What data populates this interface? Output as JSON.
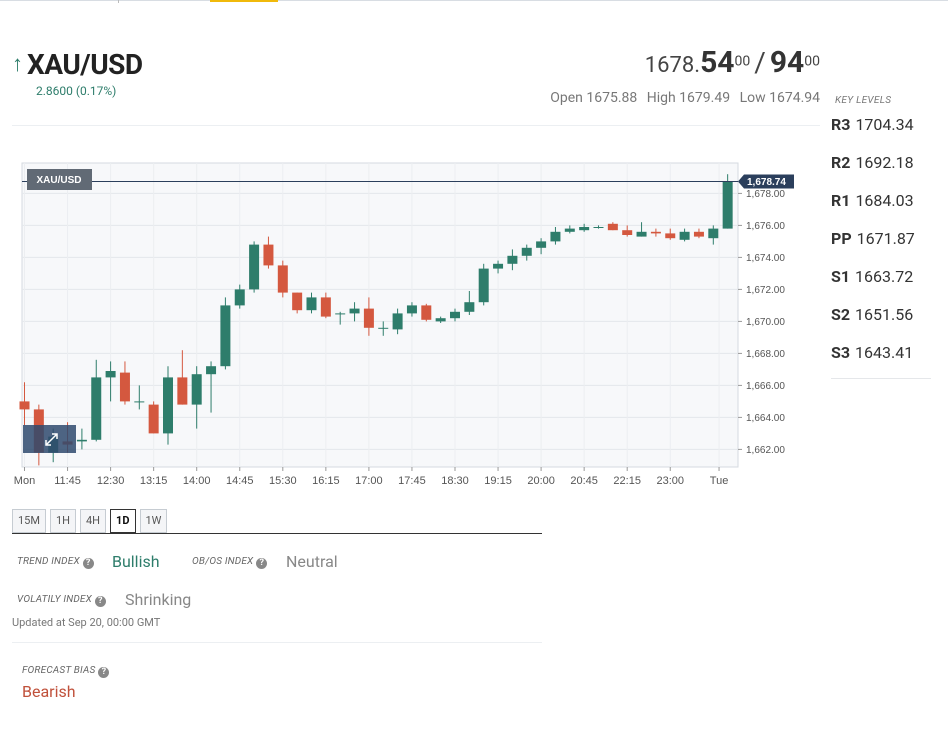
{
  "header": {
    "symbol": "XAU/USD",
    "change": "2.8600 (0.17%)",
    "bid_int": "1678.",
    "bid_big": "54",
    "bid_sup": "00",
    "slash": "/",
    "ask_big": "94",
    "ask_sup": "00",
    "open": "Open 1675.88",
    "high": "High 1679.49",
    "low": "Low 1674.94"
  },
  "key_levels": {
    "title": "KEY LEVELS",
    "items": [
      {
        "name": "R3",
        "value": "1704.34"
      },
      {
        "name": "R2",
        "value": "1692.18"
      },
      {
        "name": "R1",
        "value": "1684.03"
      },
      {
        "name": "PP",
        "value": "1671.87"
      },
      {
        "name": "S1",
        "value": "1663.72"
      },
      {
        "name": "S2",
        "value": "1651.56"
      },
      {
        "name": "S3",
        "value": "1643.41"
      }
    ]
  },
  "chart_data": {
    "type": "candlestick",
    "title": "XAU/USD",
    "current_price_label": "1,678.74",
    "current_price": 1678.74,
    "ylim": [
      1660.9,
      1679.9
    ],
    "y_ticks": [
      1662,
      1664,
      1666,
      1668,
      1670,
      1672,
      1674,
      1676,
      1678
    ],
    "y_tick_labels": [
      "1,662.00",
      "1,664.00",
      "1,666.00",
      "1,668.00",
      "1,670.00",
      "1,672.00",
      "1,674.00",
      "1,676.00",
      "1,678.00"
    ],
    "x_tick_labels": [
      "Mon",
      "11:45",
      "12:30",
      "13:15",
      "14:00",
      "14:45",
      "15:30",
      "16:15",
      "17:00",
      "17:45",
      "18:30",
      "19:15",
      "20:00",
      "20:45",
      "22:15",
      "23:00",
      "Tue"
    ],
    "x_tick_index": [
      0,
      3,
      6,
      9,
      12,
      15,
      18,
      21,
      24,
      27,
      30,
      33,
      36,
      39,
      42,
      45,
      48.4
    ],
    "bull_color": "#2e7d6b",
    "bear_color": "#d4583f",
    "candles": [
      [
        1665.0,
        1666.2,
        1663.5,
        1664.5
      ],
      [
        1664.5,
        1664.8,
        1661.0,
        1661.8
      ],
      [
        1661.8,
        1663.3,
        1661.2,
        1662.8
      ],
      [
        1662.5,
        1663.7,
        1661.8,
        1662.3
      ],
      [
        1662.5,
        1663.3,
        1662.0,
        1662.6
      ],
      [
        1662.6,
        1667.6,
        1662.5,
        1666.5
      ],
      [
        1666.5,
        1667.5,
        1665.0,
        1666.9
      ],
      [
        1666.8,
        1667.5,
        1664.8,
        1665.0
      ],
      [
        1665.0,
        1666.0,
        1664.5,
        1665.0
      ],
      [
        1664.8,
        1665.0,
        1663.0,
        1663.0
      ],
      [
        1663.0,
        1667.2,
        1662.3,
        1666.5
      ],
      [
        1666.5,
        1668.2,
        1664.8,
        1664.8
      ],
      [
        1664.8,
        1667.2,
        1663.3,
        1666.7
      ],
      [
        1666.7,
        1667.5,
        1664.3,
        1667.2
      ],
      [
        1667.2,
        1671.5,
        1667.0,
        1671.0
      ],
      [
        1671.0,
        1672.3,
        1670.8,
        1672.0
      ],
      [
        1672.0,
        1675.0,
        1671.8,
        1674.8
      ],
      [
        1674.8,
        1675.3,
        1673.3,
        1673.5
      ],
      [
        1673.5,
        1673.8,
        1671.5,
        1671.8
      ],
      [
        1671.8,
        1671.8,
        1670.5,
        1670.7
      ],
      [
        1670.7,
        1671.8,
        1670.5,
        1671.5
      ],
      [
        1671.5,
        1671.8,
        1670.2,
        1670.3
      ],
      [
        1670.5,
        1670.6,
        1669.8,
        1670.5
      ],
      [
        1670.5,
        1671.2,
        1670.0,
        1670.8
      ],
      [
        1670.8,
        1671.5,
        1669.1,
        1669.6
      ],
      [
        1669.6,
        1670.0,
        1669.1,
        1669.6
      ],
      [
        1669.5,
        1670.8,
        1669.2,
        1670.5
      ],
      [
        1670.5,
        1671.2,
        1670.3,
        1671.0
      ],
      [
        1671.0,
        1671.1,
        1670.0,
        1670.1
      ],
      [
        1670.0,
        1670.3,
        1669.9,
        1670.2
      ],
      [
        1670.2,
        1670.8,
        1670.0,
        1670.6
      ],
      [
        1670.6,
        1671.9,
        1670.4,
        1671.2
      ],
      [
        1671.2,
        1673.6,
        1671.0,
        1673.3
      ],
      [
        1673.3,
        1673.8,
        1673.0,
        1673.6
      ],
      [
        1673.6,
        1674.5,
        1673.2,
        1674.1
      ],
      [
        1674.1,
        1674.8,
        1673.8,
        1674.6
      ],
      [
        1674.6,
        1675.2,
        1674.2,
        1675.0
      ],
      [
        1675.0,
        1675.9,
        1674.8,
        1675.6
      ],
      [
        1675.6,
        1676.0,
        1675.5,
        1675.8
      ],
      [
        1675.7,
        1676.1,
        1675.6,
        1675.9
      ],
      [
        1675.9,
        1676.0,
        1675.8,
        1675.9
      ],
      [
        1676.1,
        1676.2,
        1675.7,
        1675.7
      ],
      [
        1675.7,
        1676.0,
        1675.3,
        1675.4
      ],
      [
        1675.3,
        1676.2,
        1675.3,
        1675.6
      ],
      [
        1675.6,
        1675.8,
        1675.3,
        1675.5
      ],
      [
        1675.5,
        1675.8,
        1675.1,
        1675.2
      ],
      [
        1675.1,
        1675.8,
        1675.0,
        1675.6
      ],
      [
        1675.6,
        1675.8,
        1675.2,
        1675.3
      ],
      [
        1675.2,
        1676.0,
        1674.8,
        1675.8
      ],
      [
        1675.8,
        1679.2,
        1675.8,
        1678.74
      ]
    ]
  },
  "timeframes": [
    "15M",
    "1H",
    "4H",
    "1D",
    "1W"
  ],
  "indices": {
    "trend_label": "TREND INDEX",
    "trend_value": "Bullish",
    "obos_label": "OB/OS INDEX",
    "obos_value": "Neutral",
    "volatility_label": "VOLATILY INDEX",
    "volatility_value": "Shrinking",
    "updated": "Updated at Sep 20, 00:00 GMT",
    "bias_label": "FORECAST BIAS",
    "bias_value": "Bearish"
  },
  "icons": {
    "help": "?",
    "arrow_up": "↑"
  }
}
